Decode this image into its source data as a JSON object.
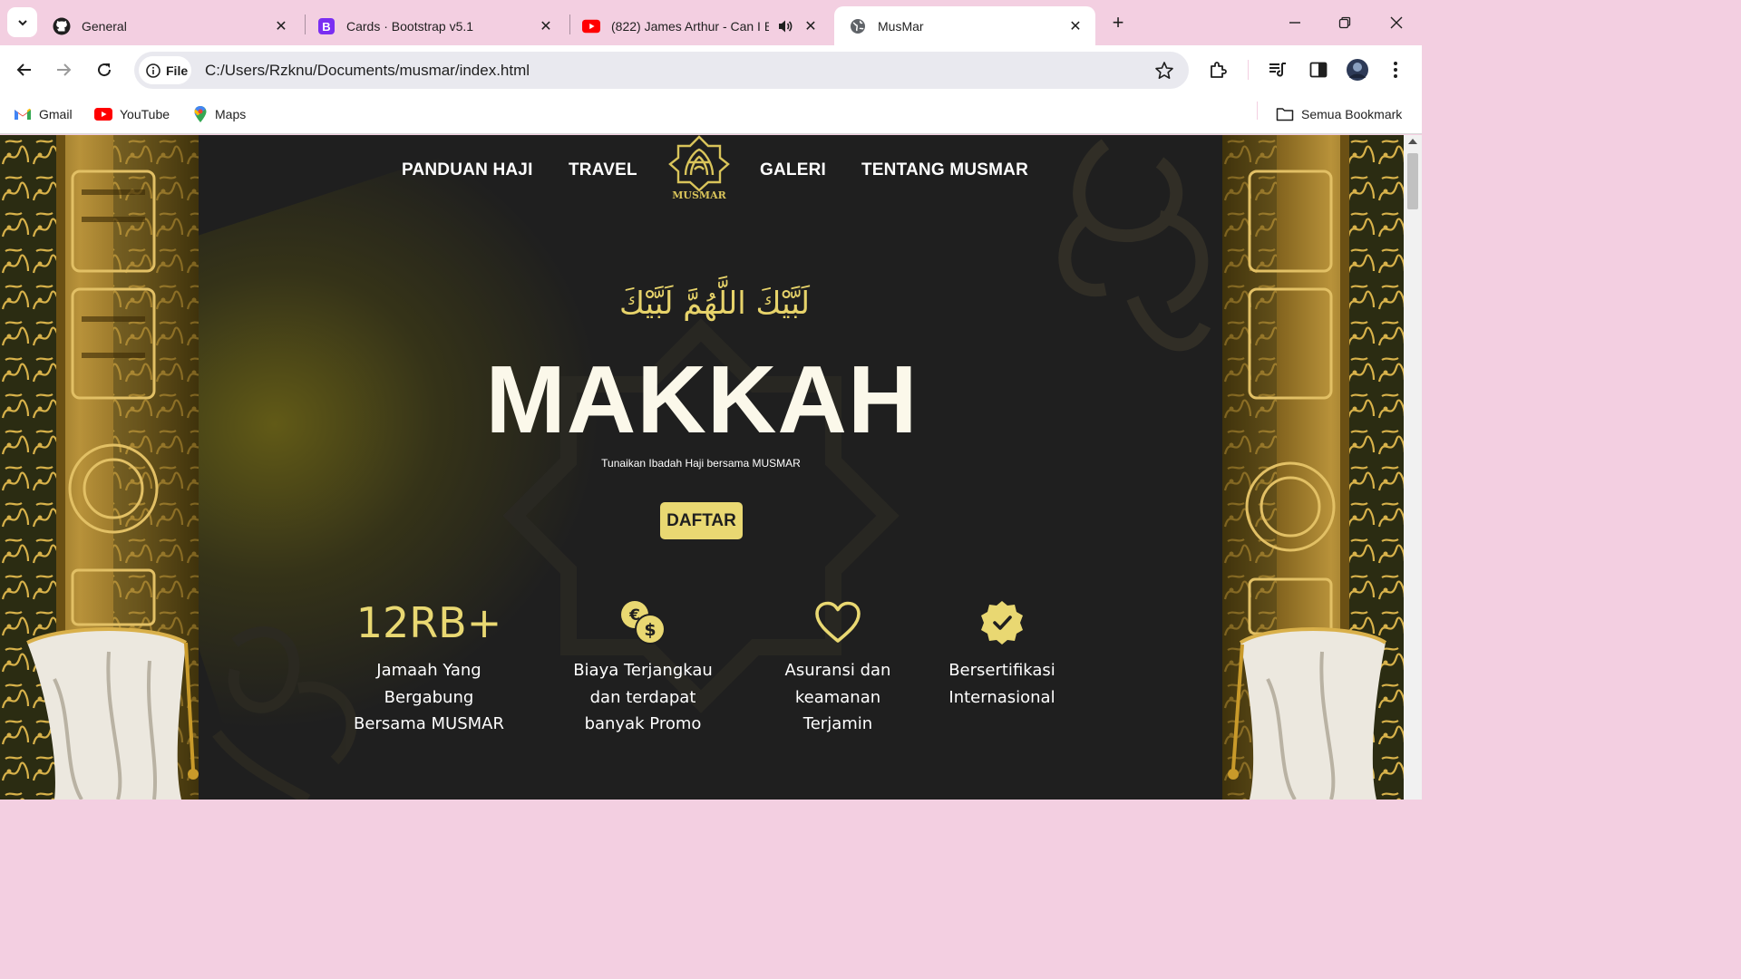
{
  "browser": {
    "tabs": [
      {
        "title": "General",
        "favicon": "github-icon"
      },
      {
        "title": "Cards · Bootstrap v5.1",
        "favicon": "bootstrap-icon"
      },
      {
        "title": "(822) James Arthur - Can I B",
        "favicon": "youtube-icon",
        "audio": true
      },
      {
        "title": "MusMar",
        "favicon": "globe-icon",
        "active": true
      }
    ],
    "omnibox": {
      "chip_label": "File",
      "url": "C:/Users/Rzknu/Documents/musmar/index.html"
    },
    "bookmarks": [
      {
        "label": "Gmail",
        "icon": "gmail-icon"
      },
      {
        "label": "YouTube",
        "icon": "youtube-icon"
      },
      {
        "label": "Maps",
        "icon": "maps-icon"
      }
    ],
    "all_bookmarks_label": "Semua Bookmark",
    "theme_color": "#f3cfe1"
  },
  "page": {
    "nav": {
      "left": [
        "PANDUAN HAJI",
        "TRAVEL"
      ],
      "right": [
        "GALERI",
        "TENTANG MUSMAR"
      ],
      "logo_text": "MUSMAR"
    },
    "hero": {
      "arabic": "لَبَّيْكَ اللَّهُمَّ لَبَّيْكَ",
      "title": "MAKKAH",
      "subtitle": "Tunaikan Ibadah Haji bersama MUSMAR",
      "cta_label": "DAFTAR"
    },
    "features": [
      {
        "stat": "12RB+",
        "caption_lines": [
          "Jamaah Yang",
          "Bergabung",
          "Bersama MUSMAR"
        ]
      },
      {
        "icon": "currency-coins-icon",
        "caption_lines": [
          "Biaya Terjangkau",
          "dan terdapat",
          "banyak Promo"
        ]
      },
      {
        "icon": "heart-icon",
        "caption_lines": [
          "Asuransi dan",
          "keamanan",
          "Terjamin"
        ]
      },
      {
        "icon": "verified-badge-icon",
        "caption_lines": [
          "Bersertifikasi",
          "Internasional"
        ]
      }
    ],
    "colors": {
      "accent": "#e9d872",
      "background": "#1f1f1f",
      "text": "#ffffff"
    }
  }
}
